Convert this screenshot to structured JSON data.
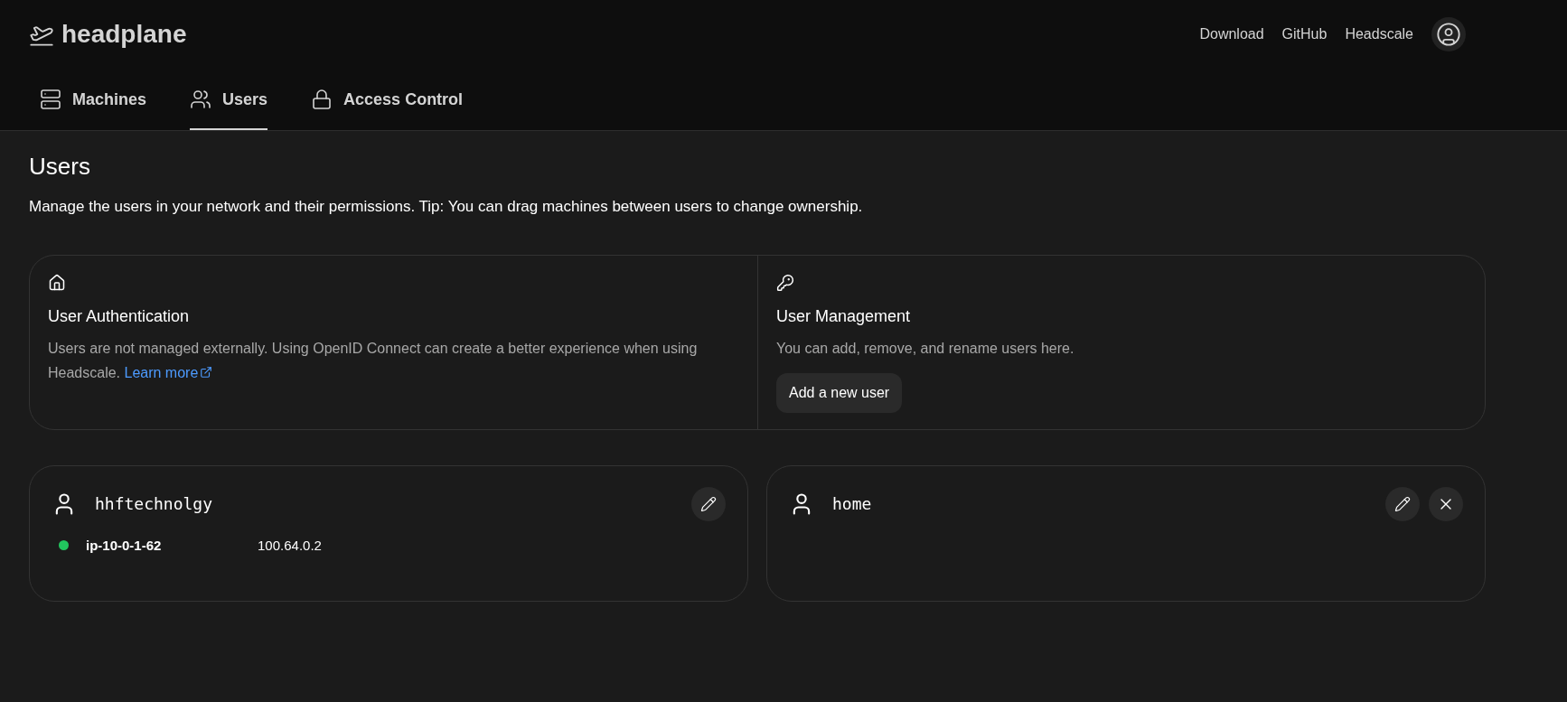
{
  "brand": {
    "name": "headplane"
  },
  "header_links": [
    "Download",
    "GitHub",
    "Headscale"
  ],
  "tabs": [
    {
      "label": "Machines",
      "kind": "machines",
      "selected": false
    },
    {
      "label": "Users",
      "kind": "users",
      "selected": true
    },
    {
      "label": "Access Control",
      "kind": "acl",
      "selected": false
    }
  ],
  "page": {
    "title": "Users",
    "description": "Manage the users in your network and their permissions. Tip: You can drag machines between users to change ownership."
  },
  "info_cards": [
    {
      "kind": "auth",
      "title": "User Authentication",
      "text": "Users are not managed externally. Using OpenID Connect can create a better experience when using Headscale.",
      "link": "Learn more"
    },
    {
      "kind": "manage",
      "title": "User Management",
      "text": "You can add, remove, and rename users here.",
      "button": "Add a new user"
    }
  ],
  "users": [
    {
      "name": "hhftechnolgy",
      "deletable": false,
      "machines": [
        {
          "name": "ip-10-0-1-62",
          "address": "100.64.0.2",
          "online": true
        }
      ]
    },
    {
      "name": "home",
      "deletable": true
    }
  ]
}
